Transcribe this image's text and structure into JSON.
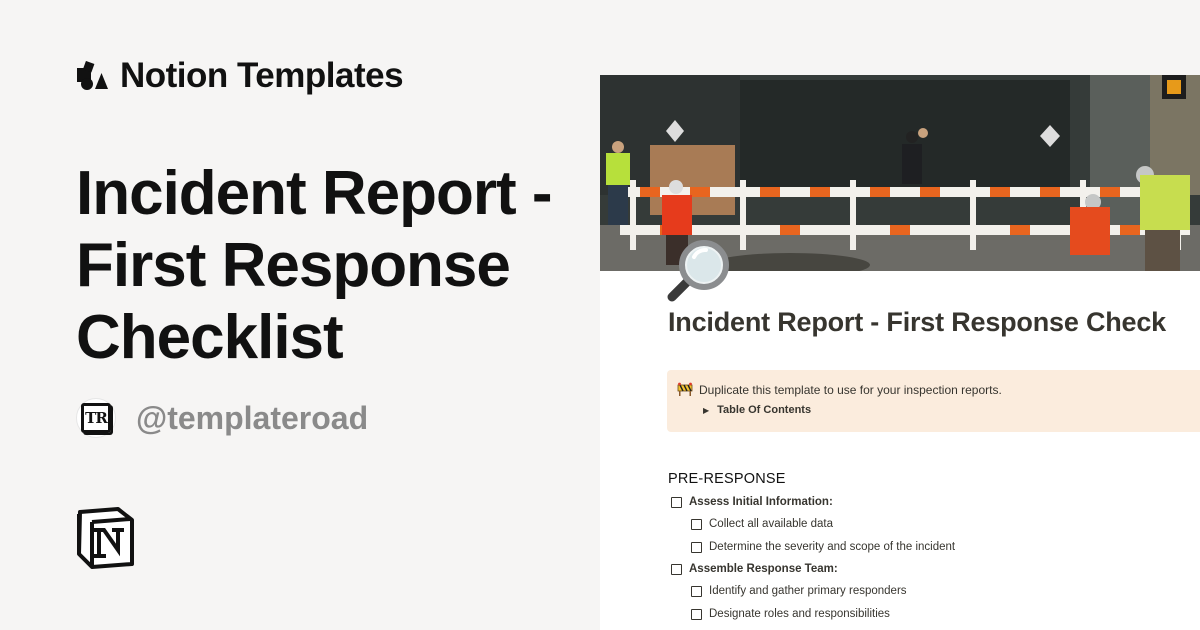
{
  "brand": {
    "name": "Notion Templates"
  },
  "headline": {
    "lines": [
      "Incident Report -",
      "First Response",
      "Checklist"
    ]
  },
  "author": {
    "handle": "@templateroad",
    "avatar_text": "TR"
  },
  "preview": {
    "page_title": "Incident Report - First Response Check",
    "callout": {
      "text": "Duplicate this template to use for your inspection reports.",
      "toc_label": "Table Of Contents"
    },
    "section_heading": "PRE-RESPONSE",
    "checklist": [
      {
        "label": "Assess Initial Information:",
        "level": 0,
        "bold": true
      },
      {
        "label": "Collect all available data",
        "level": 1,
        "bold": false
      },
      {
        "label": "Determine the severity and scope of the incident",
        "level": 1,
        "bold": false
      },
      {
        "label": "Assemble Response Team:",
        "level": 0,
        "bold": true
      },
      {
        "label": "Identify and gather primary responders",
        "level": 1,
        "bold": false
      },
      {
        "label": "Designate roles and responsibilities",
        "level": 1,
        "bold": false
      }
    ]
  },
  "colors": {
    "background": "#f6f5f4",
    "callout_bg": "#fbecdd",
    "handle_gray": "#8a8a8a",
    "text_dark": "#37352f"
  },
  "icons": [
    "notion-templates-logo-icon",
    "magnifying-glass-icon",
    "construction-barrier-icon",
    "notion-logo-icon",
    "toggle-arrow-icon",
    "checkbox-icon"
  ]
}
